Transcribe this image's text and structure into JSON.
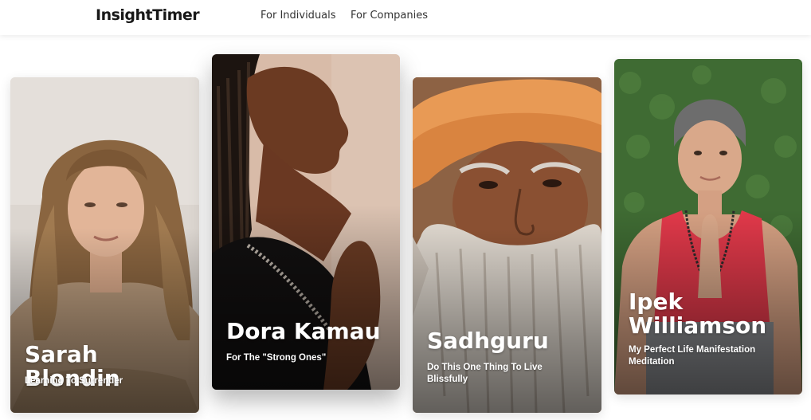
{
  "header": {
    "logo": "InsightTimer",
    "nav": [
      "For Individuals",
      "For Companies"
    ]
  },
  "cards": [
    {
      "name": "Sarah Blondin",
      "subtitle": "Learning To Surrender"
    },
    {
      "name": "Dora Kamau",
      "subtitle": "For The \"Strong Ones\""
    },
    {
      "name": "Sadhguru",
      "subtitle": "Do This One Thing To Live Blissfully"
    },
    {
      "name": "Ipek Williamson",
      "subtitle": "My Perfect Life Manifestation Meditation"
    }
  ],
  "colors": {
    "card1_bg": "#d9d2cb",
    "card2_bg": "#d7b9a7",
    "card3_bg": "#8a5a3c",
    "card4_bg": "#3f6b33",
    "turban": "#e99a55",
    "tank_top": "#e53a48"
  }
}
